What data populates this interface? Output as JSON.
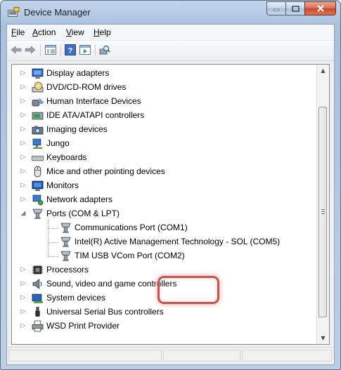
{
  "window": {
    "title": "Device Manager"
  },
  "menu": [
    {
      "pre": "",
      "accel": "F",
      "post": "ile"
    },
    {
      "pre": "",
      "accel": "A",
      "post": "ction"
    },
    {
      "pre": "",
      "accel": "V",
      "post": "iew"
    },
    {
      "pre": "",
      "accel": "H",
      "post": "elp"
    }
  ],
  "toolbar": [
    "back-icon",
    "forward-icon",
    "show-hide-tree-icon",
    "properties-help-icon",
    "update-driver-icon",
    "scan-hardware-icon"
  ],
  "tree": [
    {
      "label": "Display adapters",
      "icon": "display-icon",
      "expander": "▷"
    },
    {
      "label": "DVD/CD-ROM drives",
      "icon": "dvd-drive-icon",
      "expander": "▷"
    },
    {
      "label": "Human Interface Devices",
      "icon": "hid-icon",
      "expander": "▷"
    },
    {
      "label": "IDE ATA/ATAPI controllers",
      "icon": "ide-controller-icon",
      "expander": "▷"
    },
    {
      "label": "Imaging devices",
      "icon": "camera-icon",
      "expander": "▷"
    },
    {
      "label": "Jungo",
      "icon": "network-device-icon",
      "expander": "▷"
    },
    {
      "label": "Keyboards",
      "icon": "keyboard-icon",
      "expander": "▷"
    },
    {
      "label": "Mice and other pointing devices",
      "icon": "mouse-icon",
      "expander": "▷"
    },
    {
      "label": "Monitors",
      "icon": "monitor-icon",
      "expander": "▷"
    },
    {
      "label": "Network adapters",
      "icon": "network-adapter-icon",
      "expander": "▷"
    },
    {
      "label": "Ports (COM & LPT)",
      "icon": "port-icon",
      "expander": "◢"
    },
    {
      "label": "Communications Port (COM1)",
      "icon": "port-icon",
      "child": true
    },
    {
      "label": "Intel(R) Active Management Technology - SOL (COM5)",
      "icon": "port-icon",
      "child": true
    },
    {
      "label": "TIM USB VCom Port (COM2)",
      "icon": "port-icon",
      "child": true
    },
    {
      "label": "Processors",
      "icon": "processor-icon",
      "expander": "▷"
    },
    {
      "label": "Sound, video and game controllers",
      "icon": "speaker-icon",
      "expander": "▷"
    },
    {
      "label": "System devices",
      "icon": "system-device-icon",
      "expander": "▷"
    },
    {
      "label": "Universal Serial Bus controllers",
      "icon": "usb-icon",
      "expander": "▷"
    },
    {
      "label": "WSD Print Provider",
      "icon": "printer-icon",
      "expander": "▷"
    }
  ],
  "colors": {
    "highlight": "#b85a52",
    "titlebar": "#b2c8e2"
  }
}
